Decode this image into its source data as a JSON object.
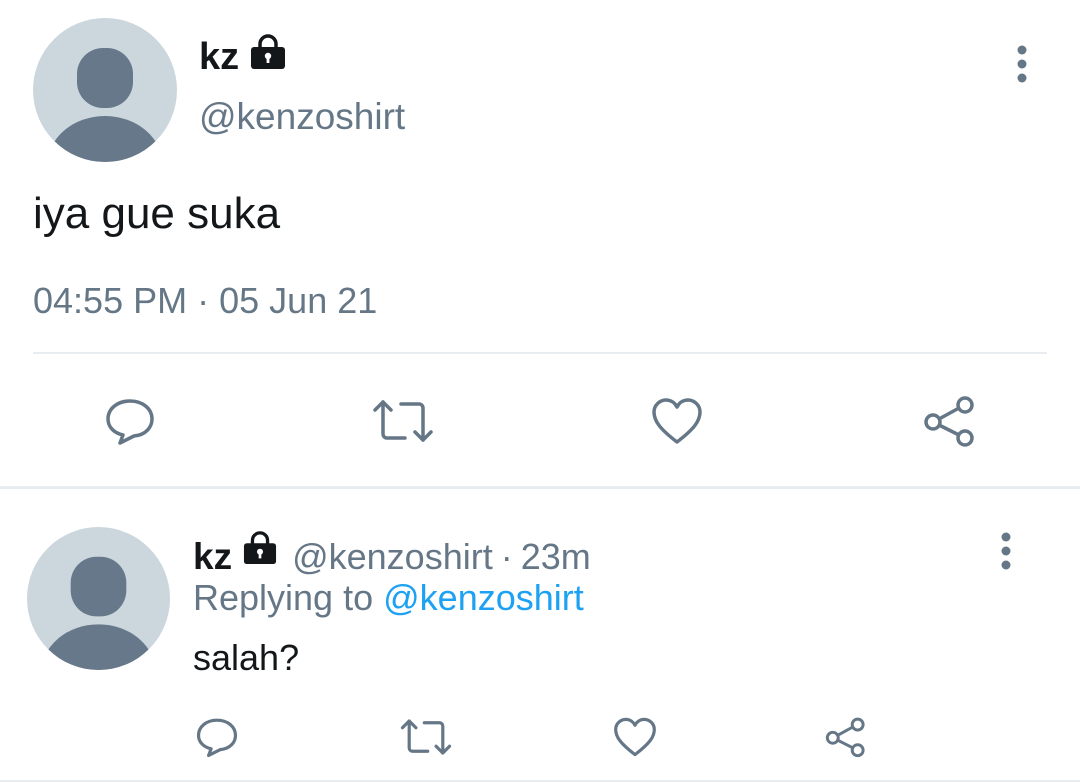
{
  "main_tweet": {
    "display_name": "kz",
    "handle": "@kenzoshirt",
    "text": "iya gue suka",
    "time": "04:55 PM",
    "separator": "·",
    "date": "05 Jun 21",
    "actions": [
      "reply-icon",
      "retweet-icon",
      "like-icon",
      "share-icon"
    ]
  },
  "reply_tweet": {
    "display_name": "kz",
    "handle": "@kenzoshirt",
    "separator": "·",
    "time_ago": "23m",
    "replying_label": "Replying to",
    "replying_to": "@kenzoshirt",
    "text": "salah?",
    "actions": [
      "reply-icon",
      "retweet-icon",
      "like-icon",
      "share-icon"
    ]
  },
  "colors": {
    "primary_text": "#14171a",
    "secondary_text": "#657786",
    "link": "#1da1f2",
    "avatar_bg": "#ccd6dd",
    "avatar_fg": "#66788a",
    "divider": "#e6ecf0"
  }
}
